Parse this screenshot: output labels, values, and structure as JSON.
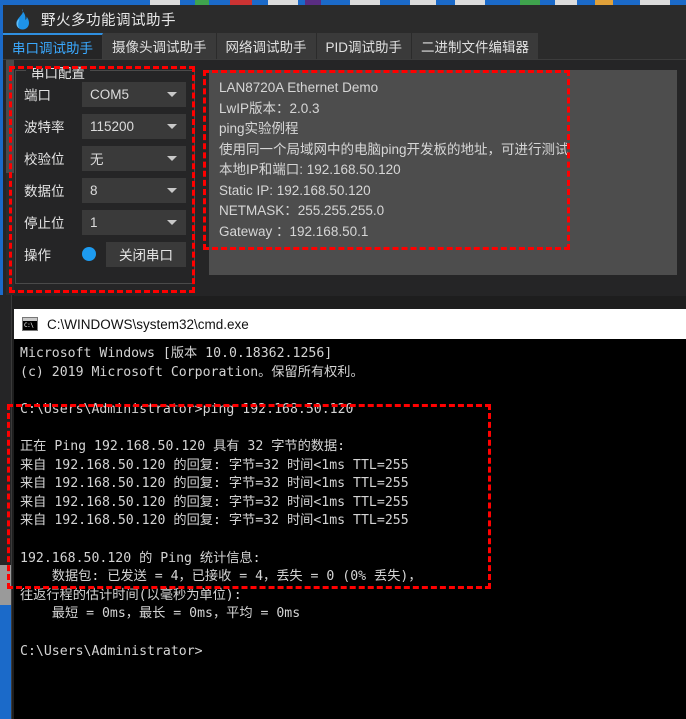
{
  "window": {
    "title": "野火多功能调试助手",
    "logo_icon": "flame-icon"
  },
  "tabs": [
    {
      "label": "串口调试助手",
      "active": true
    },
    {
      "label": "摄像头调试助手",
      "active": false
    },
    {
      "label": "网络调试助手",
      "active": false
    },
    {
      "label": "PID调试助手",
      "active": false
    },
    {
      "label": "二进制文件编辑器",
      "active": false
    }
  ],
  "serial_config": {
    "group_title": "串口配置",
    "rows": [
      {
        "label": "端口",
        "value": "COM5"
      },
      {
        "label": "波特率",
        "value": "115200"
      },
      {
        "label": "校验位",
        "value": "无"
      },
      {
        "label": "数据位",
        "value": "8"
      },
      {
        "label": "停止位",
        "value": "1"
      }
    ],
    "action": {
      "label": "操作",
      "indicator_color": "#1d9bf0",
      "button_label": "关闭串口"
    }
  },
  "receive_area": {
    "text": "LAN8720A Ethernet Demo\nLwIP版本：2.0.3\nping实验例程\n使用同一个局域网中的电脑ping开发板的地址，可进行测试\n本地IP和端口: 192.168.50.120\nStatic IP: 192.168.50.120\nNETMASK：255.255.255.0\nGateway ：192.168.50.1"
  },
  "console": {
    "title": "C:\\WINDOWS\\system32\\cmd.exe",
    "title_icon": "cmd-icon",
    "text": "Microsoft Windows [版本 10.0.18362.1256]\n(c) 2019 Microsoft Corporation。保留所有权利。\n\nC:\\Users\\Administrator>ping 192.168.50.120\n\n正在 Ping 192.168.50.120 具有 32 字节的数据:\n来自 192.168.50.120 的回复: 字节=32 时间<1ms TTL=255\n来自 192.168.50.120 的回复: 字节=32 时间<1ms TTL=255\n来自 192.168.50.120 的回复: 字节=32 时间<1ms TTL=255\n来自 192.168.50.120 的回复: 字节=32 时间<1ms TTL=255\n\n192.168.50.120 的 Ping 统计信息:\n    数据包: 已发送 = 4，已接收 = 4，丢失 = 0 (0% 丢失)，\n往返行程的估计时间(以毫秒为单位):\n    最短 = 0ms，最长 = 0ms，平均 = 0ms\n\nC:\\Users\\Administrator>"
  },
  "annotations": {
    "highlight_color": "#ff0000",
    "boxes": [
      {
        "name": "serial-config-highlight"
      },
      {
        "name": "demo-info-highlight"
      },
      {
        "name": "ping-result-highlight"
      }
    ]
  }
}
